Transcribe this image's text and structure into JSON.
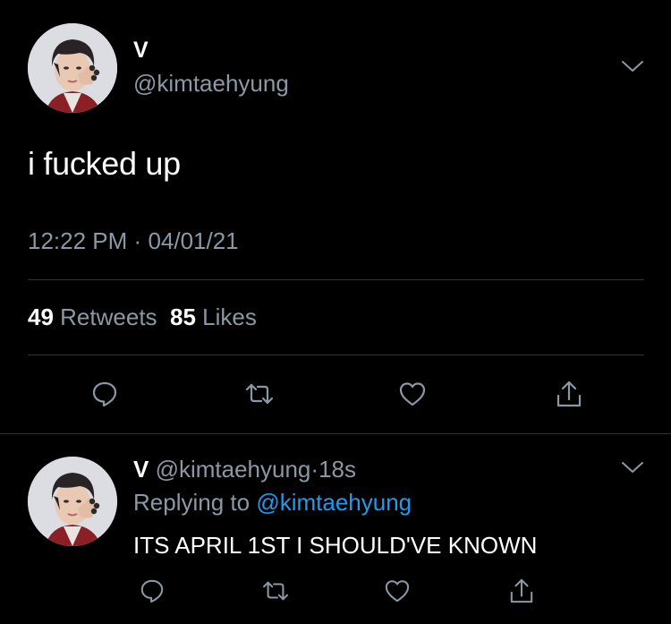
{
  "tweet": {
    "name": "V",
    "handle": "@kimtaehyung",
    "text": "i fucked up",
    "time": "12:22 PM",
    "separator": "·",
    "date": "04/01/21",
    "retweets_count": "49",
    "retweets_label": "Retweets",
    "likes_count": "85",
    "likes_label": "Likes"
  },
  "reply": {
    "name": "V",
    "handle": "@kimtaehyung",
    "separator": "·",
    "age": "18s",
    "replying_prefix": "Replying to",
    "replying_handle": "@kimtaehyung",
    "text": "ITS APRIL 1ST I SHOULD'VE KNOWN"
  },
  "icons": {
    "reply": "reply-bubble-icon",
    "retweet": "retweet-arrows-icon",
    "like": "heart-icon",
    "share": "share-upload-icon",
    "more": "chevron-down-icon"
  },
  "colors": {
    "background": "#000000",
    "text": "#ffffff",
    "secondary": "#8b98a5",
    "link": "#1d9bf0",
    "divider": "#2f3336"
  }
}
